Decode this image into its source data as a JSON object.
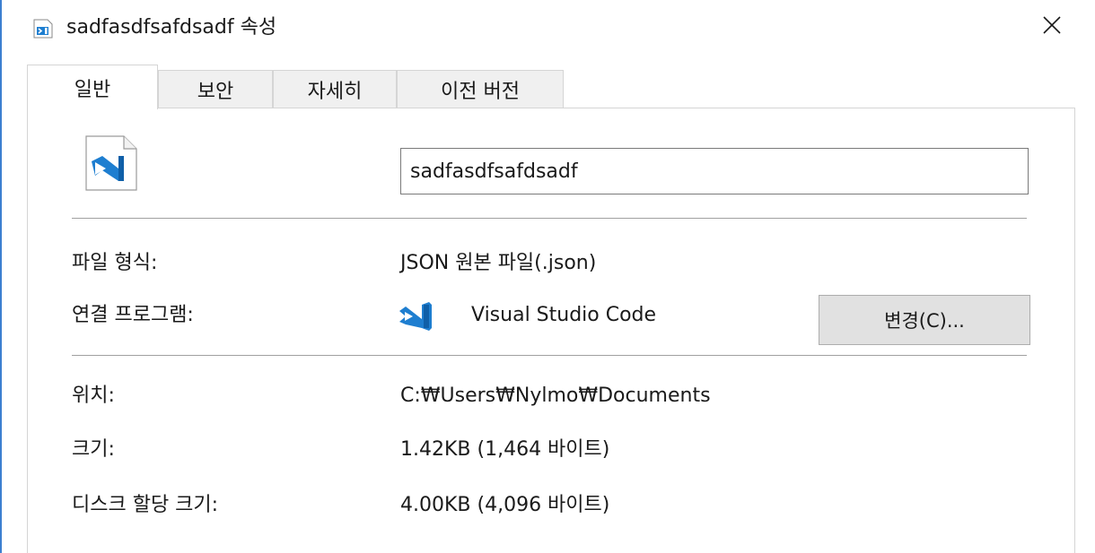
{
  "window": {
    "title": "sadfasdfsafdsadf 속성",
    "close_glyph": "✕"
  },
  "tabs": [
    {
      "label": "일반",
      "active": true
    },
    {
      "label": "보안",
      "active": false
    },
    {
      "label": "자세히",
      "active": false
    },
    {
      "label": "이전 버전",
      "active": false
    }
  ],
  "general": {
    "file_name": "sadfasdfsafdsadf",
    "file_type_label": "파일 형식:",
    "file_type_value": "JSON 원본 파일(.json)",
    "opens_with_label": "연결 프로그램:",
    "opens_with_value": "Visual Studio Code",
    "change_button": "변경(C)...",
    "location_label": "위치:",
    "location_value": "C:₩Users₩Nylmo₩Documents",
    "size_label": "크기:",
    "size_value": "1.42KB (1,464 바이트)",
    "disk_size_label": "디스크 할당 크기:",
    "disk_size_value": "4.00KB (4,096 바이트)"
  },
  "icons": {
    "title": "vscode-file-icon",
    "file": "vscode-file-icon",
    "app": "vscode-app-icon",
    "close": "close-icon"
  },
  "colors": {
    "accent": "#1e7ed0",
    "tab_inactive": "#f0f0f0",
    "button_bg": "#e1e1e1"
  }
}
